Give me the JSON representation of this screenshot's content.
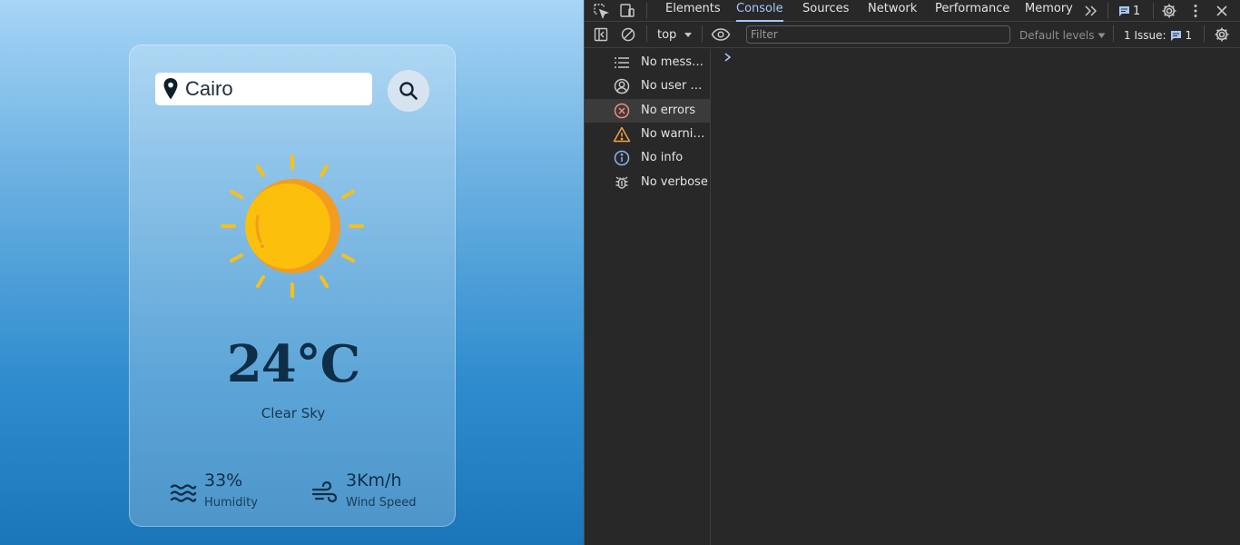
{
  "weather_app": {
    "search": {
      "value": "Cairo",
      "placeholder": ""
    },
    "temperature": "24°C",
    "description": "Clear Sky",
    "humidity": {
      "value": "33%",
      "label": "Humidity"
    },
    "wind": {
      "value": "3Km/h",
      "label": "Wind Speed"
    },
    "icons": [
      "map-pin-icon",
      "search-icon",
      "sun-icon",
      "waves-icon",
      "wind-icon"
    ]
  },
  "devtools": {
    "tabs": [
      "Elements",
      "Console",
      "Sources",
      "Network",
      "Performance",
      "Memory"
    ],
    "active_tab": "Console",
    "issue_badge_count": "1",
    "toolbar": {
      "context": "top",
      "filter_placeholder": "Filter",
      "levels": "Default levels",
      "issues_label": "1 Issue:",
      "issues_count": "1"
    },
    "sidebar": [
      {
        "label": "No messages",
        "icon": "list-icon"
      },
      {
        "label": "No user messages",
        "icon": "user-icon"
      },
      {
        "label": "No errors",
        "icon": "error-icon",
        "color": "#f28b82"
      },
      {
        "label": "No warnings",
        "icon": "warning-icon",
        "color": "#f29d49"
      },
      {
        "label": "No info",
        "icon": "info-icon",
        "color": "#8ab4f8"
      },
      {
        "label": "No verbose",
        "icon": "bug-icon"
      }
    ],
    "colors": {
      "accent": "#a8c7fa",
      "background": "#282828"
    }
  }
}
